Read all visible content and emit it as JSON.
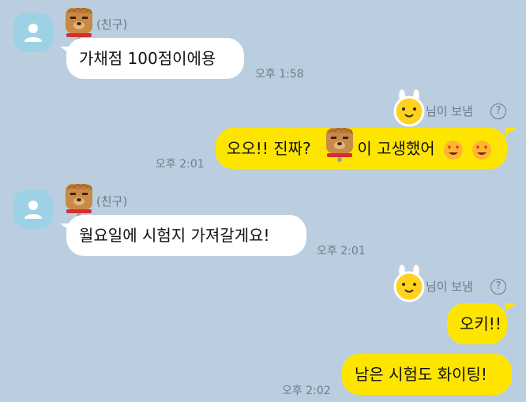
{
  "chat": {
    "friend_label": "(친구)",
    "msg1": "가채점 100점이에용",
    "time1": "오후 1:58",
    "sent_by_suffix": "님이 보냄",
    "help_icon": "?",
    "msg2_part1": "오오!! 진짜?",
    "msg2_part2": "이 고생했어",
    "time2": "오후 2:01",
    "msg3": "월요일에 시험지 가져갈게요!",
    "time3": "오후 2:01",
    "msg4": "오키!!",
    "msg5": "남은 시험도 화이팅!",
    "time5": "오후 2:02"
  },
  "colors": {
    "background": "#BACEE0",
    "outgoing_bubble": "#FEE500",
    "incoming_bubble": "#FFFFFF",
    "avatar": "#9DD2E6"
  }
}
